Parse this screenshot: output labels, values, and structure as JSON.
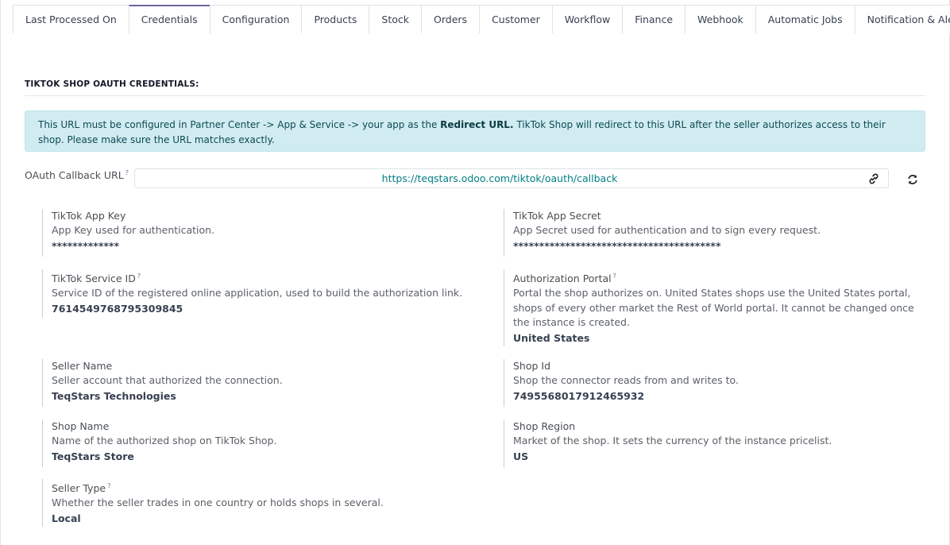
{
  "tabs": [
    {
      "label": "Last Processed On",
      "active": false
    },
    {
      "label": "Credentials",
      "active": true
    },
    {
      "label": "Configuration",
      "active": false
    },
    {
      "label": "Products",
      "active": false
    },
    {
      "label": "Stock",
      "active": false
    },
    {
      "label": "Orders",
      "active": false
    },
    {
      "label": "Customer",
      "active": false
    },
    {
      "label": "Workflow",
      "active": false
    },
    {
      "label": "Finance",
      "active": false
    },
    {
      "label": "Webhook",
      "active": false
    },
    {
      "label": "Automatic Jobs",
      "active": false
    },
    {
      "label": "Notification & Alerts",
      "active": false
    }
  ],
  "section_title": "TIKTOK SHOP OAUTH CREDENTIALS:",
  "alert": {
    "part1": "This URL must be configured in Partner Center -> App & Service -> your app as the ",
    "bold": "Redirect URL.",
    "part2": " TikTok Shop will redirect to this URL after the seller authorizes access to their shop. Please make sure the URL matches exactly."
  },
  "callback": {
    "label": "OAuth Callback URL",
    "help_marker": "?",
    "value": "https://teqstars.odoo.com/tiktok/oauth/callback"
  },
  "fields": {
    "app_key": {
      "label": "TikTok App Key",
      "help": "App Key used for authentication.",
      "value": "*************"
    },
    "app_secret": {
      "label": "TikTok App Secret",
      "help": "App Secret used for authentication and to sign every request.",
      "value": "****************************************"
    },
    "service_id": {
      "label": "TikTok Service ID",
      "marker": "?",
      "help": "Service ID of the registered online application, used to build the authorization link.",
      "value": "7614549768795309845"
    },
    "auth_portal": {
      "label": "Authorization Portal",
      "marker": "?",
      "help": "Portal the shop authorizes on. United States shops use the United States portal, shops of every other market the Rest of World portal. It cannot be changed once the instance is created.",
      "value": "United States"
    },
    "seller_name": {
      "label": "Seller Name",
      "help": "Seller account that authorized the connection.",
      "value": "TeqStars Technologies"
    },
    "shop_id": {
      "label": "Shop Id",
      "help": "Shop the connector reads from and writes to.",
      "value": "7495568017912465932"
    },
    "shop_name": {
      "label": "Shop Name",
      "help": "Name of the authorized shop on TikTok Shop.",
      "value": "TeqStars Store"
    },
    "shop_region": {
      "label": "Shop Region",
      "help": "Market of the shop. It sets the currency of the instance pricelist.",
      "value": "US"
    },
    "seller_type": {
      "label": "Seller Type",
      "marker": "?",
      "help": "Whether the seller trades in one country or holds shops in several.",
      "value": "Local"
    }
  },
  "colors": {
    "accent_tab": "#71639e",
    "link": "#017e84",
    "alert_bg": "#d1ecf1"
  },
  "icons": {
    "link": "link-icon",
    "refresh": "refresh-icon"
  }
}
